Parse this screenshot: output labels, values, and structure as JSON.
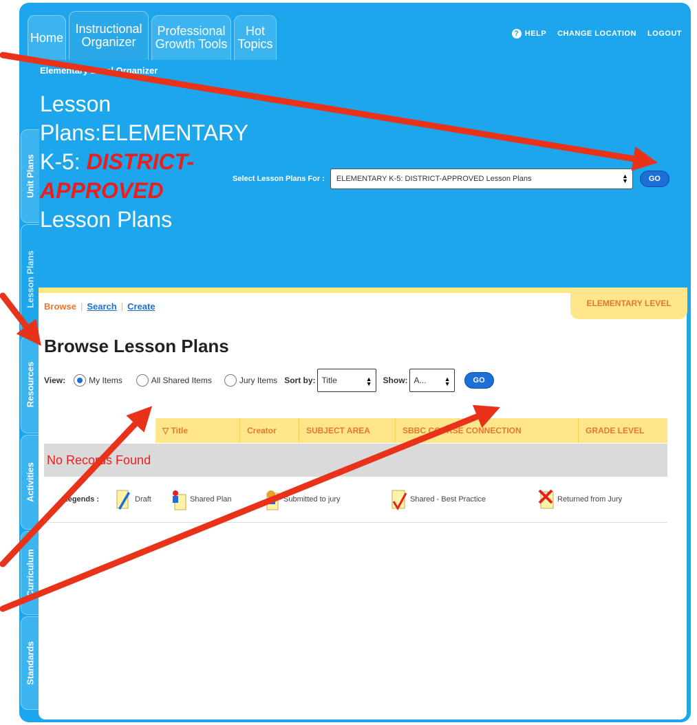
{
  "tabs": [
    {
      "line1": "Home",
      "line2": ""
    },
    {
      "line1": "Instructional",
      "line2": "Organizer"
    },
    {
      "line1": "Professional",
      "line2": "Growth Tools"
    },
    {
      "line1": "Hot",
      "line2": "Topics"
    }
  ],
  "topnav": {
    "help": "HELP",
    "change_location": "CHANGE LOCATION",
    "logout": "LOGOUT"
  },
  "org_label": "Elementary Level Organizer",
  "page_title": {
    "line1": "Lesson",
    "line2": "Plans:ELEMENTARY",
    "line3a": "K-5: ",
    "line3b": "DISTRICT-",
    "line4": "APPROVED",
    "line5": "Lesson Plans"
  },
  "lesson_select": {
    "label": "Select  Lesson Plans For :",
    "value": "ELEMENTARY K-5: DISTRICT-APPROVED Lesson Plans",
    "go": "GO"
  },
  "side_tabs": [
    "Unit Plans",
    "Lesson Plans",
    "Resources",
    "Activities",
    "Curriculum",
    "Standards"
  ],
  "level_badge": "ELEMENTARY LEVEL",
  "subnav": {
    "browse": "Browse",
    "search": "Search",
    "create": "Create"
  },
  "browse_title": "Browse Lesson Plans",
  "view": {
    "label": "View:",
    "options": [
      "My Items",
      "All Shared Items",
      "Jury Items"
    ],
    "sort_label": "Sort by:",
    "sort_value": "Title",
    "show_label": "Show:",
    "show_value": "A...",
    "go": "GO"
  },
  "table": {
    "headers": [
      "▽ Title",
      "Creator",
      "SUBJECT AREA",
      "SBBC COURSE CONNECTION",
      "GRADE LEVEL"
    ],
    "empty": "No Records Found"
  },
  "legend": {
    "label": "Legends :",
    "items": [
      "Draft",
      "Shared Plan",
      "Submitted to jury",
      "Shared - Best Practice",
      "Returned from Jury"
    ]
  }
}
